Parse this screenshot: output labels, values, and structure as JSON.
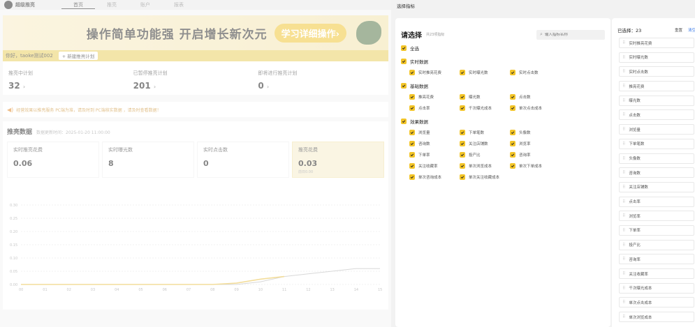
{
  "background": {
    "brand": "超级推亮",
    "nav_tabs": [
      "首页",
      "推亮",
      "账户",
      "报表"
    ],
    "banner": {
      "text": "操作简单功能强 开启增长新次元",
      "button": "学习详细操作›"
    },
    "greeting": "你好，taoke测试002",
    "new_plan": "+ 新建推亮计划",
    "stats": [
      {
        "label": "推亮中计划",
        "value": "32",
        "arrow": "›"
      },
      {
        "label": "已暂停推亮计划",
        "value": "201",
        "arrow": "›"
      },
      {
        "label": "即将进行推亮计划",
        "value": "0",
        "arrow": "›"
      }
    ],
    "notice": "经营效果以推亮服务 PC端为准，请及时到 PC端核实数据 ，请及时查看数据！",
    "section_title": "推亮数据",
    "section_time": "数据更新时间：2025-01-20 11:00:00",
    "cards": [
      {
        "label": "实时推亮花费",
        "value": "0.06",
        "sub": ""
      },
      {
        "label": "实时曝光数",
        "value": "8",
        "sub": ""
      },
      {
        "label": "实时点击数",
        "value": "0",
        "sub": ""
      },
      {
        "label": "推亮花费",
        "value": "0.03",
        "sub": "前日0.00"
      }
    ]
  },
  "chart_data": {
    "type": "line",
    "x": [
      "00",
      "01",
      "02",
      "03",
      "04",
      "05",
      "06",
      "07",
      "08",
      "09",
      "10",
      "11",
      "12",
      "13",
      "14",
      "15"
    ],
    "y_ticks": [
      "0.00",
      "0.05",
      "0.10",
      "0.15",
      "0.20",
      "0.25",
      "0.30"
    ],
    "ylim": [
      0,
      0.3
    ],
    "series": [
      {
        "values": [
          0,
          0,
          0,
          0,
          0,
          0,
          0,
          0,
          0,
          0,
          0.01,
          0.03,
          0.04,
          0.05,
          0.06,
          0.06
        ],
        "color": "#b8b8b8"
      },
      {
        "values": [
          0,
          0,
          0,
          0,
          0,
          0,
          0,
          0,
          0,
          0.005,
          0.02,
          0.03,
          null,
          null,
          null,
          null
        ],
        "color": "#e9c24a"
      }
    ]
  },
  "drawer": {
    "title": "选择指标",
    "picker_title": "请选择",
    "picker_count": "共23项指标",
    "search_placeholder": "输入指标名称",
    "select_all": "全选",
    "groups": [
      {
        "title": "实时数据",
        "items": [
          "实时推亮花费",
          "实时曝光数",
          "实时点击数"
        ]
      },
      {
        "title": "基础数据",
        "items": [
          "推亮花费",
          "曝光数",
          "点击数",
          "点击率",
          "千次曝光成本",
          "单次点击成本"
        ]
      },
      {
        "title": "效果数据",
        "items": [
          "浏览量",
          "下单笔数",
          "头像数",
          "咨询数",
          "关注店铺数",
          "浏览率",
          "下单率",
          "投产比",
          "咨询率",
          "关注收藏率",
          "单次浏览成本",
          "单次下单成本",
          "单次咨询成本",
          "单次关注收藏成本"
        ]
      }
    ],
    "selected_label": "已选择：23",
    "reset": "重置",
    "clear": "清空",
    "selected_items": [
      "实时推亮花费",
      "实时曝光数",
      "实时点击数",
      "推亮花费",
      "曝光数",
      "点击数",
      "浏览量",
      "下单笔数",
      "头像数",
      "咨询数",
      "关注店铺数",
      "点击率",
      "浏览率",
      "下单率",
      "投产比",
      "咨询率",
      "关注收藏率",
      "千次曝光成本",
      "单次点击成本",
      "单次浏览成本"
    ]
  }
}
